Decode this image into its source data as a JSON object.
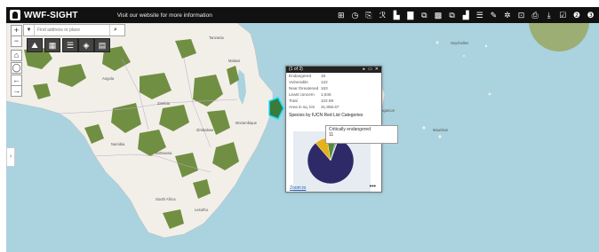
{
  "header": {
    "title": "WWF-SIGHT",
    "tagline": "Visit our website for more information"
  },
  "toolbar": [
    "⊞",
    "◷",
    "⎘",
    "ℛ",
    "▙",
    "▇",
    "⧉",
    "▩",
    "⧉",
    "▟",
    "☰",
    "✎",
    "✲",
    "⊡",
    "⎙",
    "⤓",
    "☑",
    "❷",
    "❸"
  ],
  "search": {
    "placeholder": "Find address or place"
  },
  "popup": {
    "title": "(1 of 3)",
    "controls": [
      "▸",
      "▭",
      "✕"
    ],
    "rows": [
      {
        "k": "Endangered",
        "v": "18"
      },
      {
        "k": "Vulnerable",
        "v": "122"
      },
      {
        "k": "Near threatened",
        "v": "163"
      },
      {
        "k": "Least concern",
        "v": "1,546"
      },
      {
        "k": "Total",
        "v": "102.69"
      },
      {
        "k": "Area in sq. km",
        "v": "31,856.67"
      }
    ],
    "chart_title": "Species by IUCN Red List Categories",
    "zoom_link": "Zoom to",
    "more": "•••",
    "tooltip": {
      "label": "Critically endangered",
      "value": "11"
    }
  },
  "chart_data": {
    "type": "pie",
    "slices": [
      {
        "label": "Least concern",
        "value": 1546,
        "color": "#2e2a68"
      },
      {
        "label": "Near threatened",
        "value": 163,
        "color": "#e6b21a"
      },
      {
        "label": "Vulnerable",
        "value": 122,
        "color": "#5a8a3a"
      },
      {
        "label": "Endangered",
        "value": 18,
        "color": "#3c6d8a"
      },
      {
        "label": "Critically endangered",
        "value": 11,
        "color": "#cfcfcf"
      }
    ]
  },
  "map_labels": [
    "Angola",
    "Zambia",
    "Namibia",
    "Botswana",
    "Zimbabwe",
    "Mozambique",
    "South Africa",
    "Lesotho",
    "Madagascar",
    "Mauritius",
    "Seychelles",
    "Tanzania",
    "Malawi"
  ],
  "colors": {
    "water": "#aad3df",
    "land": "#f2efe9",
    "protected": "#6b8a3a"
  }
}
